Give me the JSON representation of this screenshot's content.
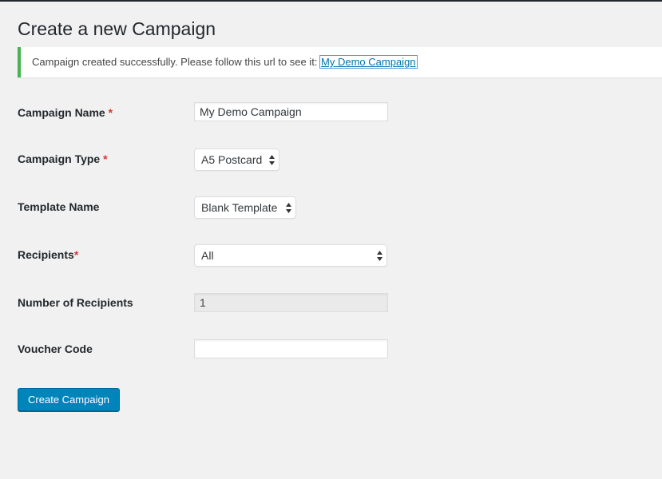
{
  "page": {
    "title": "Create a new Campaign"
  },
  "notice": {
    "message": "Campaign created successfully. Please follow this url to see it: ",
    "link_text": "My Demo Campaign",
    "accent_color": "#46b450"
  },
  "form": {
    "campaign_name": {
      "label": "Campaign Name",
      "required_mark": "*",
      "value": "My Demo Campaign"
    },
    "campaign_type": {
      "label": "Campaign Type",
      "required_mark": "*",
      "selected": "A5 Postcard"
    },
    "template_name": {
      "label": "Template Name",
      "selected": "Blank Template"
    },
    "recipients": {
      "label": "Recipients",
      "required_mark": "*",
      "selected": "All"
    },
    "number_of_recipients": {
      "label": "Number of Recipients",
      "value": "1"
    },
    "voucher_code": {
      "label": "Voucher Code",
      "value": ""
    },
    "submit": {
      "label": "Create Campaign",
      "color": "#0085ba"
    }
  },
  "colors": {
    "required": "#dc3232",
    "link": "#0073aa"
  }
}
